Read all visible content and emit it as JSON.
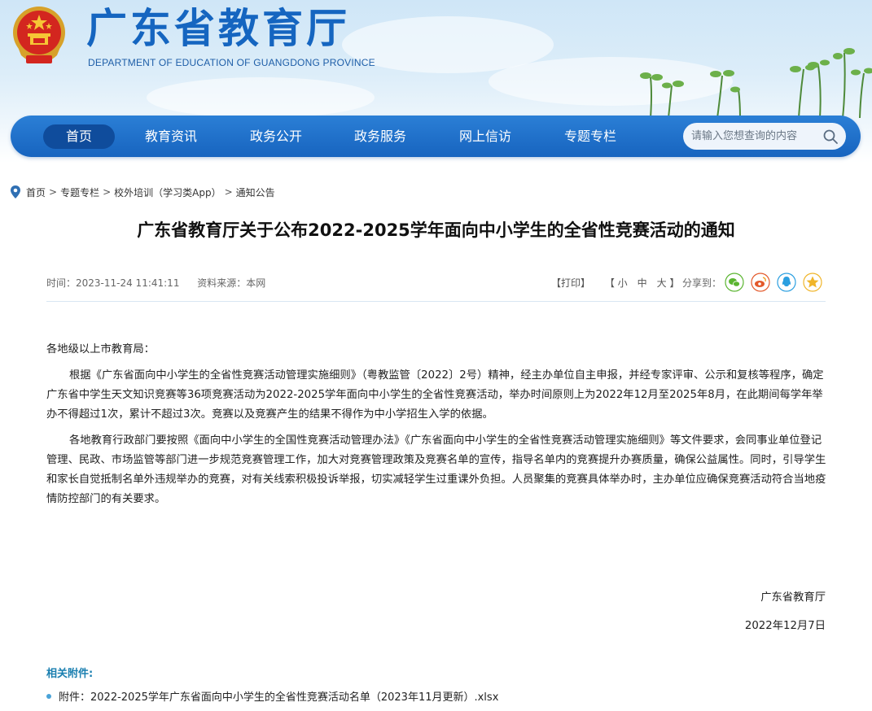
{
  "header": {
    "site_title": "广东省教育厅",
    "site_subtitle": "DEPARTMENT OF EDUCATION OF GUANGDONG PROVINCE"
  },
  "nav": {
    "items": [
      {
        "label": "首页",
        "active": true
      },
      {
        "label": "教育资讯"
      },
      {
        "label": "政务公开"
      },
      {
        "label": "政务服务"
      },
      {
        "label": "网上信访"
      },
      {
        "label": "专题专栏"
      }
    ],
    "search_placeholder": "请输入您想查询的内容"
  },
  "breadcrumb": {
    "items": [
      "首页",
      "专题专栏",
      "校外培训（学习类App）",
      "通知公告"
    ],
    "separator": ">"
  },
  "article": {
    "title": "广东省教育厅关于公布2022-2025学年面向中小学生的全省性竞赛活动的通知",
    "time": "时间：2023-11-24 11:41:11",
    "source": "资料来源：本网",
    "print": "【打印】",
    "font_size": "【 小　中　大 】",
    "share_label": "分享到：",
    "salutation": "各地级以上市教育局：",
    "paragraphs": [
      "根据《广东省面向中小学生的全省性竞赛活动管理实施细则》（粤教监管〔2022〕2号）精神，经主办单位自主申报，并经专家评审、公示和复核等程序，确定广东省中学生天文知识竞赛等36项竞赛活动为2022-2025学年面向中小学生的全省性竞赛活动，举办时间原则上为2022年12月至2025年8月，在此期间每学年举办不得超过1次，累计不超过3次。竞赛以及竞赛产生的结果不得作为中小学招生入学的依据。",
      "各地教育行政部门要按照《面向中小学生的全国性竞赛活动管理办法》《广东省面向中小学生的全省性竞赛活动管理实施细则》等文件要求，会同事业单位登记管理、民政、市场监管等部门进一步规范竞赛管理工作，加大对竞赛管理政策及竞赛名单的宣传，指导名单内的竞赛提升办赛质量，确保公益属性。同时，引导学生和家长自觉抵制名单外违规举办的竞赛，对有关线索积极投诉举报，切实减轻学生过重课外负担。人员聚集的竞赛具体举办时，主办单位应确保竞赛活动符合当地疫情防控部门的有关要求。"
    ],
    "signature": "广东省教育厅",
    "date": "2022年12月7日"
  },
  "attachments": {
    "title": "相关附件:",
    "items": [
      "附件：2022-2025学年广东省面向中小学生的全省性竞赛活动名单（2023年11月更新）.xlsx"
    ]
  },
  "colors": {
    "brand": "#1565c0",
    "nav_bg": "#1e6fcb",
    "nav_active": "#0f4c9c",
    "attach_title": "#1a7fb0",
    "share_wechat": "#5bb531",
    "share_weibo": "#e3592b",
    "share_qq": "#2b9fe0",
    "share_qzone": "#f0b52a"
  }
}
